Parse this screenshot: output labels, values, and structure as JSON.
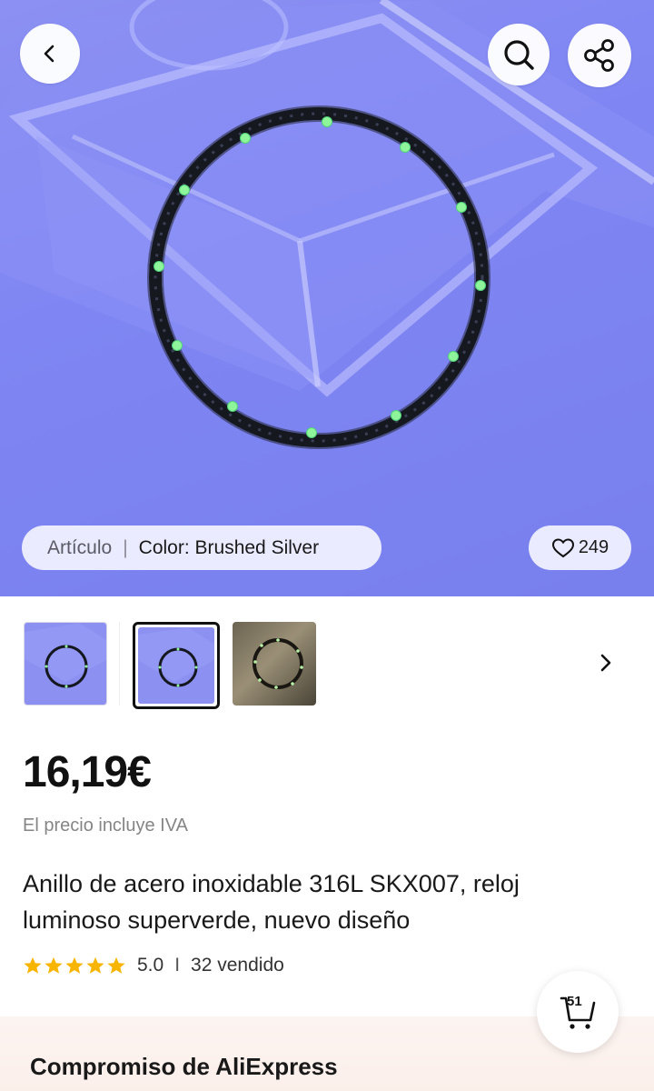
{
  "header": {
    "back_icon": "chevron-left-icon",
    "search_icon": "search-icon",
    "share_icon": "share-icon"
  },
  "gallery": {
    "variant_label": "Artículo",
    "variant_separator": "|",
    "variant_value": "Color: Brushed Silver",
    "wishlist_count": "249",
    "thumbnails_count": 3,
    "selected_thumbnail": 2
  },
  "product": {
    "price": "16,19€",
    "vat_note": "El precio incluye IVA",
    "title": "Anillo de acero inoxidable 316L SKX007, reloj luminoso superverde, nuevo diseño",
    "rating": "5.0",
    "rating_separator": "I",
    "sold": "32 vendido",
    "stars": 5
  },
  "cart": {
    "count": "51"
  },
  "commitment": {
    "title": "Compromiso de AliExpress"
  },
  "colors": {
    "hero_bg": "#8086f2",
    "star": "#f7b500",
    "lume": "#8ef59a",
    "bezel": "#1a1d24"
  }
}
